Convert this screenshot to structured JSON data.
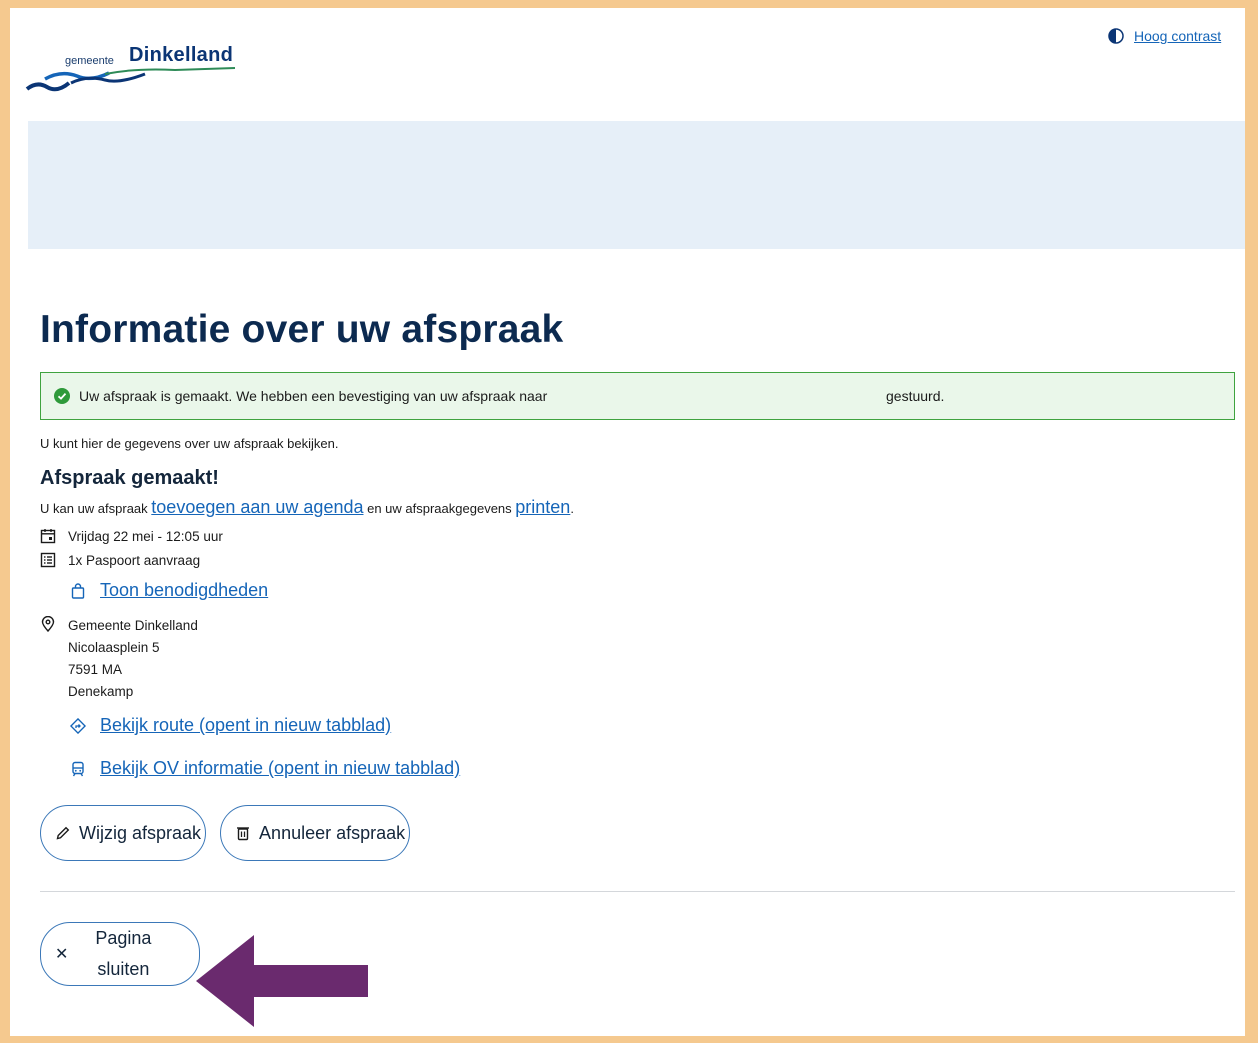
{
  "header": {
    "logo_small": "gemeente",
    "logo_big": "Dinkelland",
    "contrast_link": "Hoog contrast"
  },
  "main": {
    "title": "Informatie over uw afspraak",
    "alert_text": "Uw afspraak is gemaakt. We hebben een bevestiging van uw afspraak naar",
    "alert_suffix": "gestuurd.",
    "intro": "U kunt hier de gegevens over uw afspraak bekijken.",
    "subtitle": "Afspraak gemaakt!",
    "agenda_prefix": "U kan uw afspraak",
    "agenda_link": "toevoegen aan uw agenda",
    "agenda_middle": "en uw afspraakgegevens",
    "print_link": "printen",
    "agenda_end": ".",
    "date": "Vrijdag 22 mei - 12:05 uur",
    "product": "1x Paspoort aanvraag",
    "requirements_link": "Toon benodigdheden",
    "address": [
      "Gemeente Dinkelland",
      "Nicolaasplein 5",
      "7591 MA",
      "Denekamp"
    ],
    "route_link": "Bekijk route (opent in nieuw tabblad)",
    "ov_link": "Bekijk OV informatie (opent in nieuw tabblad)",
    "change_button": "Wijzig afspraak",
    "cancel_button": "Annuleer afspraak",
    "close_button": "Pagina sluiten"
  },
  "colors": {
    "page_border": "#f5c98f",
    "brand": "#0b3575",
    "link": "#1565b8",
    "success": "#3fa33f",
    "banner": "#e6eff8",
    "annotation_arrow": "#6a2a6e"
  }
}
